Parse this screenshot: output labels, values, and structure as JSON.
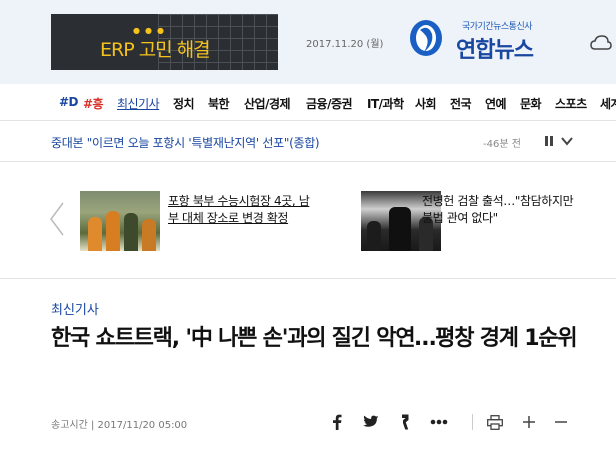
{
  "header": {
    "ad_text": "ERP 고민 해결",
    "date": "2017.11.20 (월)",
    "agency_sub": "국가기간뉴스통신사",
    "brand": "연합뉴스",
    "brand_color": "#1846a0"
  },
  "nav": {
    "items": [
      "#D",
      "#흥",
      "최신기사",
      "정치",
      "북한",
      "산업/경제",
      "금융/증권",
      "IT/과학",
      "사회",
      "전국",
      "연예",
      "문화",
      "스포츠",
      "세계"
    ]
  },
  "breaking": {
    "text": "중대본 \"이르면 오늘 포항시 '특별재난지역' 선포\"(종합)",
    "time": "-46분 전"
  },
  "carousel": {
    "cards": [
      {
        "title": "포항 북부 수능시험장 4곳, 남부 대체 장소로 변경 확정"
      },
      {
        "title": "전병헌 검찰 출석…\"참담하지만 불법 관여 없다\""
      }
    ]
  },
  "article": {
    "section": "최신기사",
    "headline": "한국 쇼트트랙, '中 나쁜 손'과의 질긴 악연…평창 경계 1순위",
    "pubtime": "송고시간 | 2017/11/20 05:00"
  },
  "icons": {
    "share": [
      "facebook-icon",
      "twitter-icon",
      "kakao-story-icon",
      "more-icon",
      "print-icon",
      "font-plus-icon",
      "font-minus-icon"
    ]
  }
}
